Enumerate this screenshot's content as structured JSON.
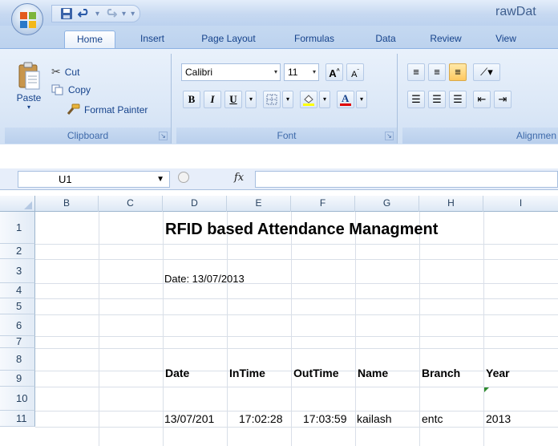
{
  "window": {
    "title": "rawDat"
  },
  "tabs": [
    {
      "label": "Home",
      "active": true
    },
    {
      "label": "Insert"
    },
    {
      "label": "Page Layout"
    },
    {
      "label": "Formulas"
    },
    {
      "label": "Data"
    },
    {
      "label": "Review"
    },
    {
      "label": "View"
    }
  ],
  "clipboard": {
    "paste": "Paste",
    "cut": "Cut",
    "copy": "Copy",
    "format_painter": "Format Painter",
    "label": "Clipboard"
  },
  "font": {
    "name": "Calibri",
    "size": "11",
    "bold": "B",
    "italic": "I",
    "underline": "U",
    "label": "Font"
  },
  "alignment": {
    "label": "Alignmen"
  },
  "formula_bar": {
    "name_box": "U1",
    "fx": "fx",
    "value": ""
  },
  "columns": [
    "B",
    "C",
    "D",
    "E",
    "F",
    "G",
    "H",
    "I"
  ],
  "rows": [
    "1",
    "2",
    "3",
    "4",
    "5",
    "6",
    "7",
    "8",
    "9",
    "10",
    "11"
  ],
  "sheet": {
    "title": "RFID based Attendance Managment",
    "date_line": "Date: 13/07/2013",
    "headers": [
      "Date",
      "InTime",
      "OutTime",
      "Name",
      "Branch",
      "Year"
    ],
    "record": [
      "13/07/201",
      "17:02:28",
      "17:03:59",
      "kailash",
      "entc",
      "2013"
    ]
  },
  "colors": {
    "accent": "#15428b",
    "highlight": "#ffc860",
    "font_color": "#e00000",
    "fill_color": "#ffff00"
  }
}
